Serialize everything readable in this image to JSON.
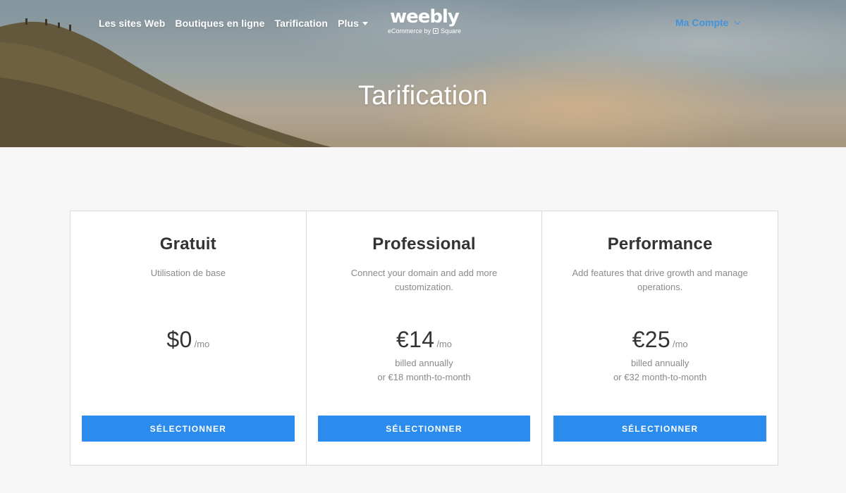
{
  "nav": {
    "links": [
      "Les sites Web",
      "Boutiques en ligne",
      "Tarification"
    ],
    "more_label": "Plus",
    "account_label": "Ma Compte"
  },
  "logo": {
    "word": "weebly",
    "sub_prefix": "eCommerce by",
    "sub_brand": "Square"
  },
  "hero": {
    "title": "Tarification"
  },
  "plans": [
    {
      "name": "Gratuit",
      "description": "Utilisation de base",
      "price": "$0",
      "unit": "/mo",
      "billing_line1": "",
      "billing_line2": "",
      "button": "SÉLECTIONNER"
    },
    {
      "name": "Professional",
      "description": "Connect your domain and add more customization.",
      "price": "€14",
      "unit": "/mo",
      "billing_line1": "billed annually",
      "billing_line2": "or €18 month-to-month",
      "button": "SÉLECTIONNER"
    },
    {
      "name": "Performance",
      "description": "Add features that drive growth and manage operations.",
      "price": "€25",
      "unit": "/mo",
      "billing_line1": "billed annually",
      "billing_line2": "or €32 month-to-month",
      "button": "SÉLECTIONNER"
    }
  ],
  "colors": {
    "accent": "#2b8ced",
    "page_bg": "#f7f7f7",
    "muted_text": "#8a8a8a"
  },
  "icons": {
    "more_caret": "caret-down-icon",
    "account_chevron": "chevron-down-icon",
    "square_logo": "square-logo-icon"
  }
}
